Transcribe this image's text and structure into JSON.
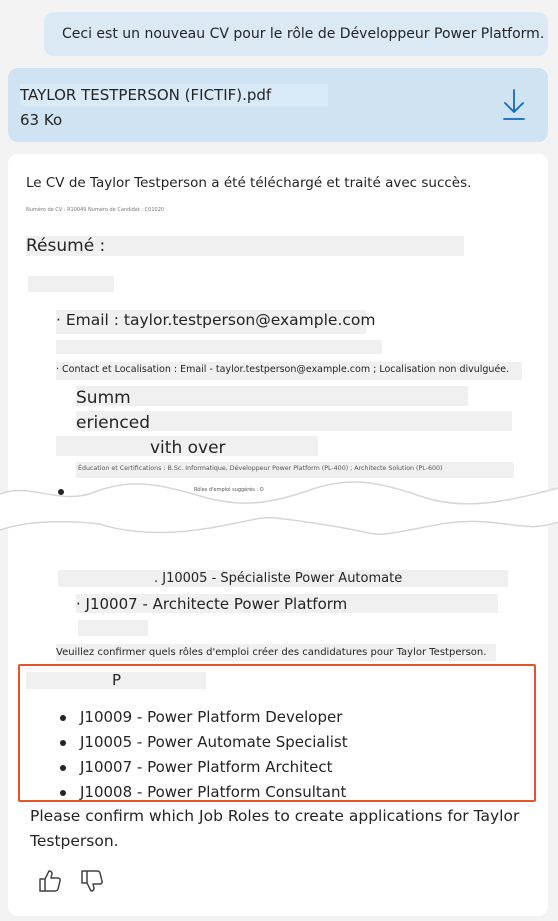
{
  "user_message": "Ceci est un nouveau CV pour le rôle de Développeur Power Platform.",
  "attachment": {
    "name": "TAYLOR TESTPERSON (FICTIF).pdf",
    "size": "63 Ko",
    "icon": "download-icon"
  },
  "response": {
    "status_line": "Le CV de Taylor Testperson a été téléchargé et traité avec succès.",
    "ids_line": "Numéro de CV : R10049 Numéro de Candidat : C01020",
    "summary_heading": "Résumé :",
    "email_item": "· Email : taylor.testperson@example.com",
    "contact_item": "· Contact et Localisation : Email - taylor.testperson@example.com ; Localisation non divulguée.",
    "frag_1": "Summ",
    "frag_2": "erienced",
    "frag_3": "vith over",
    "education_item": "Éducation et Certifications : B.Sc. Informatique, Développeur Power Platform (PL-400) ; Architecte Solution (PL-600)",
    "suggested_frag": "Rôles d'emploi suggérés : O",
    "role_fr_1": ". J10005 - Spécialiste Power Automate",
    "role_fr_2": "· J10007 - Architecte Power Platform",
    "confirm_fr": "Veuillez confirmer quels rôles d'emploi créer des candidatures pour Taylor Testperson.",
    "p_frag": "P",
    "roles": [
      "J10009 - Power Platform Developer",
      "J10005 - Power Automate Specialist",
      "J10007 - Power Platform Architect",
      "J10008 - Power Platform Consultant"
    ],
    "confirm_en": "Please confirm which Job Roles to create applications for Taylor Testperson."
  },
  "feedback": {
    "like_icon": "thumbs-up-icon",
    "dislike_icon": "thumbs-down-icon"
  },
  "colors": {
    "background": "#f3f3f3",
    "user_bubble": "#dbe9f5",
    "attachment_card": "#cfe3f3",
    "accent": "#0f6cbd",
    "highlight_border": "#e5542a"
  }
}
